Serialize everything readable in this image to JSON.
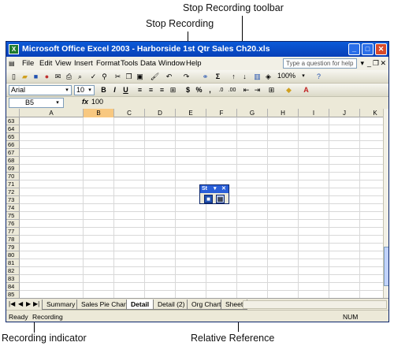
{
  "callouts": {
    "toolbar_label": "Stop Recording toolbar",
    "stop_label": "Stop Recording",
    "indicator_label": "Recording indicator",
    "relative_label": "Relative Reference"
  },
  "window": {
    "title": "Microsoft Office Excel 2003 - Harborside 1st Qtr Sales Ch20.xls",
    "help_placeholder": "Type a question for help"
  },
  "menu": {
    "items": [
      "File",
      "Edit",
      "View",
      "Insert",
      "Format",
      "Tools",
      "Data",
      "Window",
      "Help"
    ]
  },
  "toolbar": {
    "zoom": "100%",
    "font": "Arial",
    "font_size": "10",
    "bold": "B",
    "italic": "I",
    "underline": "U",
    "currency": "$",
    "percent": "%",
    "sigma": "Σ"
  },
  "formula_bar": {
    "name_box": "B5",
    "fx": "fx",
    "value": "100"
  },
  "grid": {
    "columns": [
      "A",
      "B",
      "C",
      "D",
      "E",
      "F",
      "G",
      "H",
      "I",
      "J",
      "K"
    ],
    "selected_column": "B",
    "rows": [
      "63",
      "64",
      "65",
      "66",
      "67",
      "68",
      "69",
      "70",
      "71",
      "72",
      "73",
      "74",
      "75",
      "76",
      "77",
      "78",
      "79",
      "80",
      "81",
      "82",
      "83",
      "84",
      "85"
    ]
  },
  "sheet_tabs": [
    "Summary",
    "Sales Pie Chart",
    "Detail",
    "Detail (2)",
    "Org Chart",
    "Sheet"
  ],
  "active_tab": "Detail",
  "status": {
    "ready": "Ready",
    "recording": "Recording",
    "num": "NUM"
  },
  "stop_toolbar": {
    "title": "St"
  }
}
